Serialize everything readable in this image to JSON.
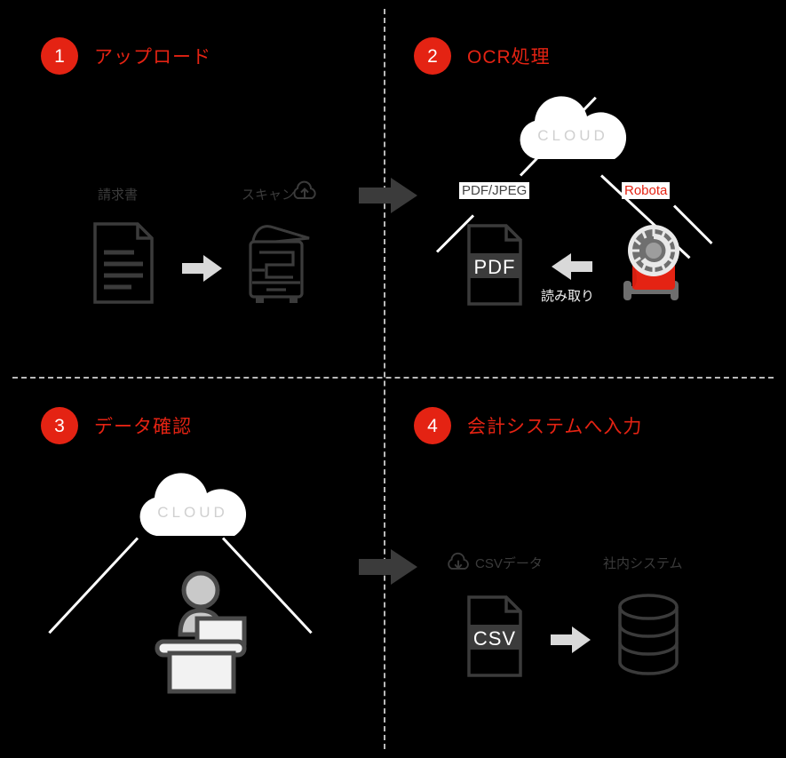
{
  "theme": {
    "background": "#000000",
    "accent_red": "#e42313",
    "icon_gray": "#3b3b3b",
    "light_gray": "#d9d9d9",
    "cloud_white": "#ffffff",
    "divider_gray": "#b9b9b9"
  },
  "steps": [
    {
      "number": "1",
      "title": "アップロード",
      "labels": {
        "source": "請求書",
        "target": "スキャン"
      },
      "icons": [
        "document-icon",
        "arrow-right-icon",
        "scanner-printer-icon",
        "cloud-upload-icon"
      ]
    },
    {
      "number": "2",
      "title": "OCR処理",
      "labels": {
        "cloud": "CLOUD",
        "left": "PDF/JPEG",
        "right": "Robota",
        "arrow": "読み取り",
        "file": "PDF"
      },
      "icons": [
        "cloud-icon",
        "pdf-file-icon",
        "arrow-left-icon",
        "robot-icon"
      ]
    },
    {
      "number": "3",
      "title": "データ確認",
      "labels": {
        "cloud": "CLOUD"
      },
      "icons": [
        "cloud-icon",
        "person-at-desk-icon"
      ]
    },
    {
      "number": "4",
      "title": "会計システムへ入力",
      "labels": {
        "left": "CSVデータ",
        "right": "社内システム",
        "file": "CSV"
      },
      "icons": [
        "cloud-download-icon",
        "csv-file-icon",
        "arrow-right-icon",
        "database-icon"
      ]
    }
  ],
  "flow_arrows": [
    {
      "name": "arrow-step1-to-step2",
      "direction": "right"
    },
    {
      "name": "arrow-step3-to-step4",
      "direction": "right"
    }
  ]
}
